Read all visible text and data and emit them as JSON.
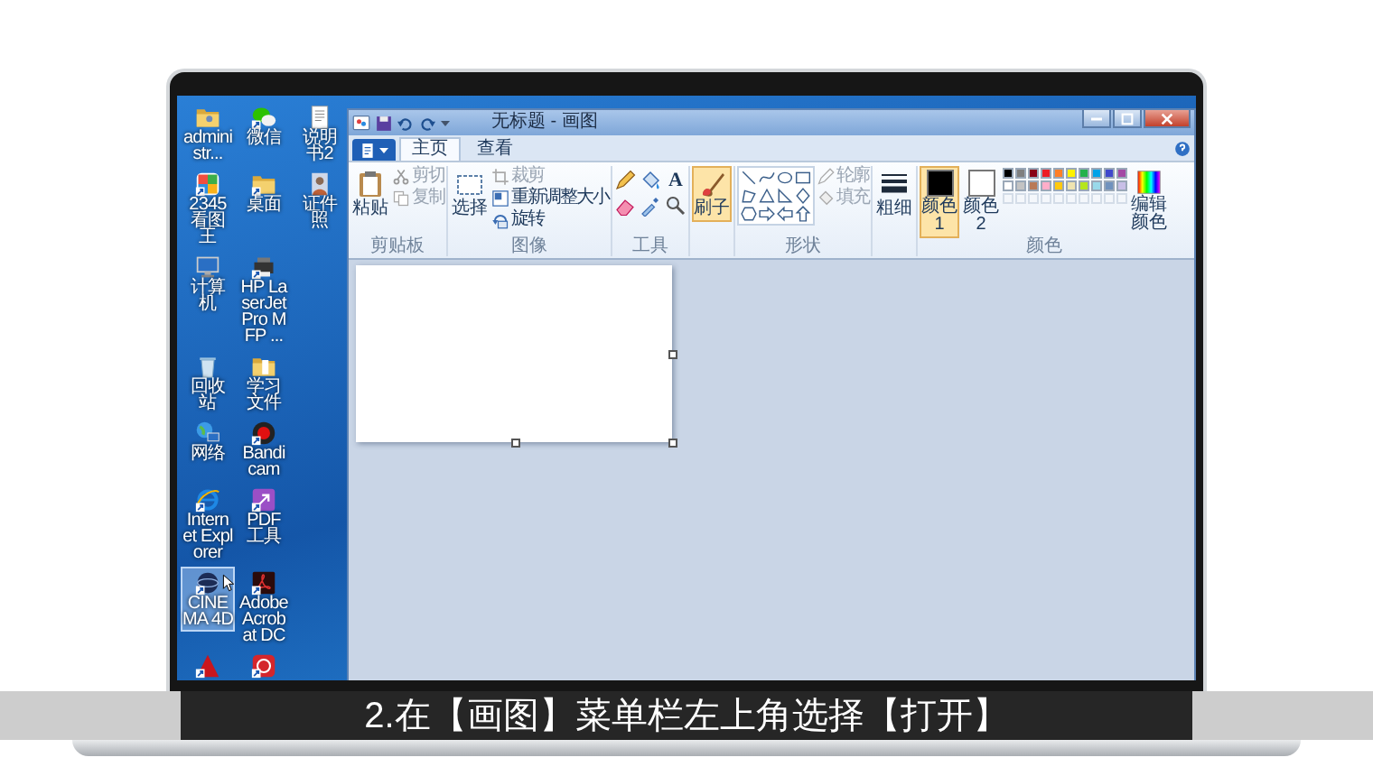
{
  "desktop": {
    "rows": [
      [
        {
          "label": "administr...",
          "selected": false
        },
        {
          "label": "微信",
          "selected": false
        },
        {
          "label": "说明书2",
          "selected": false
        }
      ],
      [
        {
          "label": "2345看图王",
          "selected": false
        },
        {
          "label": "桌面",
          "selected": false
        },
        {
          "label": "证件照",
          "selected": false
        }
      ],
      [
        {
          "label": "计算机",
          "selected": false
        },
        {
          "label": "HP LaserJet Pro MFP ...",
          "selected": false
        }
      ],
      [
        {
          "label": "回收站",
          "selected": false
        },
        {
          "label": "学习文件",
          "selected": false
        }
      ],
      [
        {
          "label": "网络",
          "selected": false
        },
        {
          "label": "Bandicam",
          "selected": false
        }
      ],
      [
        {
          "label": "Internet Explorer",
          "selected": false
        },
        {
          "label": "PDF工具",
          "selected": false
        }
      ],
      [
        {
          "label": "CINEMA 4D",
          "selected": true
        },
        {
          "label": "Adobe Acrobat DC",
          "selected": false
        }
      ],
      [
        {
          "selected": false
        },
        {
          "selected": false
        }
      ]
    ]
  },
  "paint": {
    "title": "无标题 - 画图",
    "tabs": [
      {
        "label": "主页",
        "selected": true
      },
      {
        "label": "查看",
        "selected": false
      }
    ],
    "ribbon": {
      "clipboard": {
        "label": "剪贴板",
        "paste": "粘贴",
        "items": [
          {
            "label": "剪切",
            "disabled": true
          },
          {
            "label": "复制",
            "disabled": true
          }
        ]
      },
      "image": {
        "label": "图像",
        "select": "选择",
        "items": [
          {
            "label": "裁剪",
            "disabled": true
          },
          {
            "label": "重新调整大小",
            "disabled": false
          },
          {
            "label": "旋转",
            "disabled": false
          }
        ]
      },
      "tools": {
        "label": "工具",
        "text_tool": "A"
      },
      "brushes": {
        "label": "刷子",
        "selected": true
      },
      "shapes": {
        "label": "形状",
        "items": [
          {
            "label": "轮廓",
            "disabled": true
          },
          {
            "label": "填充",
            "disabled": true
          }
        ]
      },
      "size": {
        "label": "粗细"
      },
      "colors": {
        "label": "颜色",
        "color1": {
          "label": "颜色 1",
          "color": "#000000",
          "selected": true
        },
        "color2": {
          "label": "颜色 2",
          "color": "#ffffff",
          "selected": false
        },
        "palette": [
          {
            "color": "#000000"
          },
          {
            "color": "#7f7f7f"
          },
          {
            "color": "#880015"
          },
          {
            "color": "#ed1c24"
          },
          {
            "color": "#ff7f27"
          },
          {
            "color": "#fff200"
          },
          {
            "color": "#22b14c"
          },
          {
            "color": "#00a2e8"
          },
          {
            "color": "#3f48cc"
          },
          {
            "color": "#a349a4"
          },
          {
            "color": "#ffffff"
          },
          {
            "color": "#c3c3c3"
          },
          {
            "color": "#b97a57"
          },
          {
            "color": "#ffaec9"
          },
          {
            "color": "#ffc90e"
          },
          {
            "color": "#efe4b0"
          },
          {
            "color": "#b5e61d"
          },
          {
            "color": "#99d9ea"
          },
          {
            "color": "#7092be"
          },
          {
            "color": "#c8bfe7"
          }
        ],
        "edit": "编辑颜色"
      }
    }
  },
  "subtitle": "2.在【画图】菜单栏左上角选择【打开】"
}
